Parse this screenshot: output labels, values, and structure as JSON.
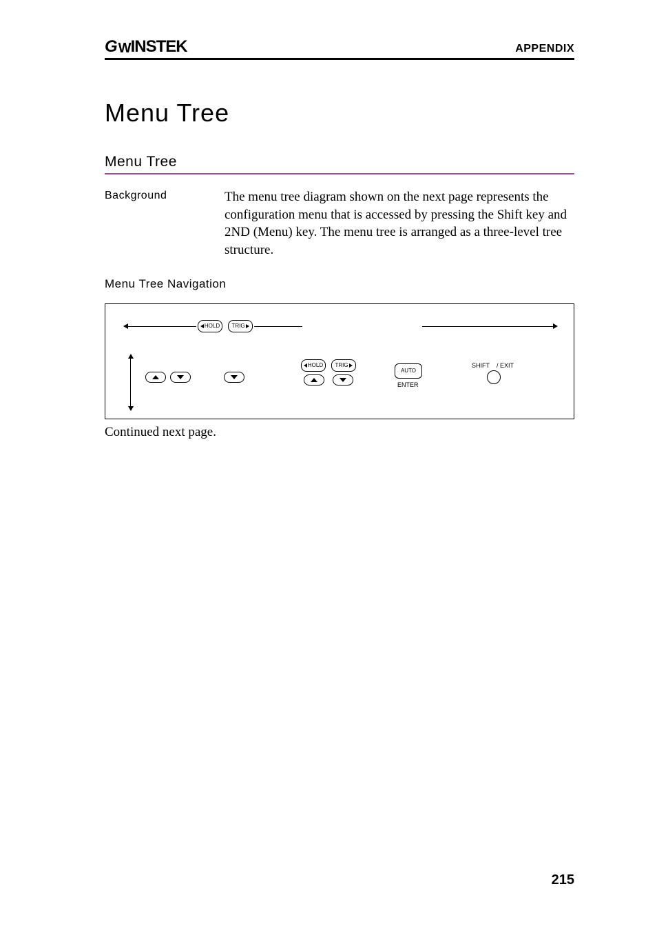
{
  "header": {
    "brand_g": "G",
    "brand_w": "W",
    "brand_rest": "INSTEK",
    "section": "APPENDIX"
  },
  "title": "Menu Tree",
  "subtitle": "Menu Tree",
  "background": {
    "label": "Background",
    "text": "The menu tree diagram shown on the next page represents the configuration menu that is accessed by pressing the Shift key and 2ND (Menu) key. The menu tree is arranged as a three-level tree structure."
  },
  "nav_heading": "Menu Tree Navigation",
  "diagram": {
    "hold": "HOLD",
    "trig": "TRIG",
    "auto": "AUTO",
    "enter": "ENTER",
    "shift": "SHIFT",
    "exit": "/ EXIT"
  },
  "continued": "Continued next page.",
  "page_number": "215"
}
